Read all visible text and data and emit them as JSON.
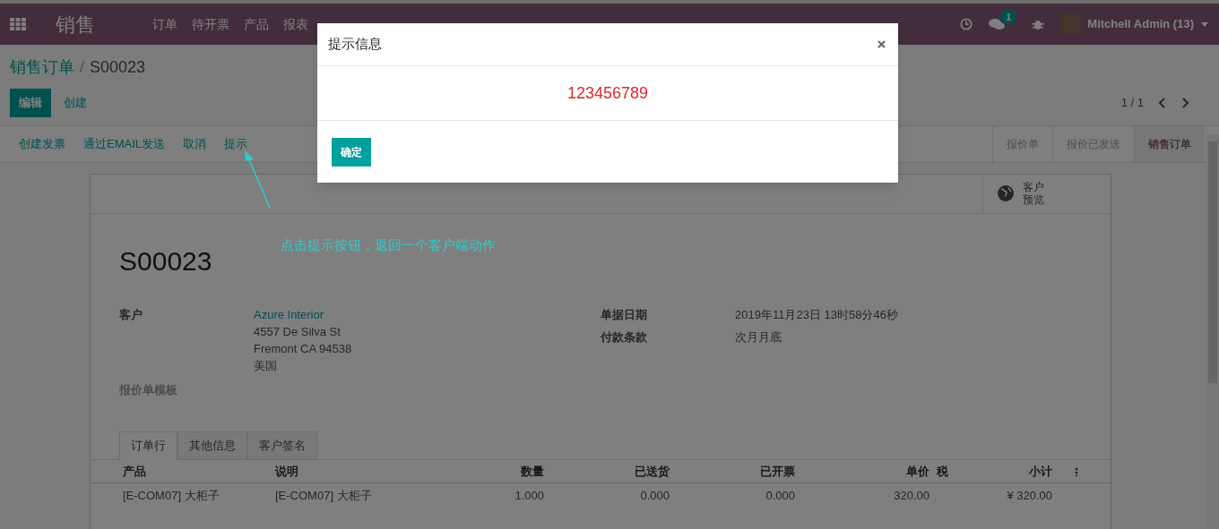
{
  "navbar": {
    "app": "销售",
    "menu": [
      "订单",
      "待开票",
      "产品",
      "报表"
    ],
    "messages_badge": "1",
    "user": "Mitchell Admin (13)"
  },
  "breadcrumb": {
    "parent": "销售订单",
    "separator": "/",
    "current": "S00023"
  },
  "actions": [
    {
      "label": "编辑",
      "kind": "primary"
    },
    {
      "label": "创建",
      "kind": "link"
    }
  ],
  "pager": "1 / 1",
  "header_buttons": [
    "创建发票",
    "通过EMAIL发送",
    "取消",
    "提示"
  ],
  "stages": [
    {
      "label": "报价单",
      "selected": false
    },
    {
      "label": "报价已发送",
      "selected": false
    },
    {
      "label": "销售订单",
      "selected": true
    }
  ],
  "smart_button": {
    "label_lines": [
      "客户",
      "预览"
    ]
  },
  "annotation": "点击提示按钮，返回一个客户端动作",
  "record": {
    "name": "S00023",
    "customer_label": "客户",
    "customer_name": "Azure Interior",
    "address": [
      "4557 De Silva St",
      "Fremont CA 94538",
      "美国"
    ],
    "template_label": "报价单模板",
    "right_fields": [
      {
        "label": "单据日期",
        "value": "2019年11月23日 13时58分46秒"
      },
      {
        "label": "付款条款",
        "value": "次月月底"
      }
    ]
  },
  "tabs": [
    {
      "label": "订单行",
      "selected": true
    },
    {
      "label": "其他信息",
      "selected": false
    },
    {
      "label": "客户签名",
      "selected": false
    }
  ],
  "table": {
    "columns": [
      "产品",
      "说明",
      "数量",
      "已送货",
      "已开票",
      "单价",
      "税",
      "小计"
    ],
    "rows": [
      [
        "[E-COM07] 大柜子",
        "[E-COM07] 大柜子",
        "1.000",
        "0.000",
        "0.000",
        "320.00",
        "",
        "¥ 320.00"
      ]
    ]
  },
  "dialog": {
    "title": "提示信息",
    "message": "123456789",
    "button": "确定"
  }
}
